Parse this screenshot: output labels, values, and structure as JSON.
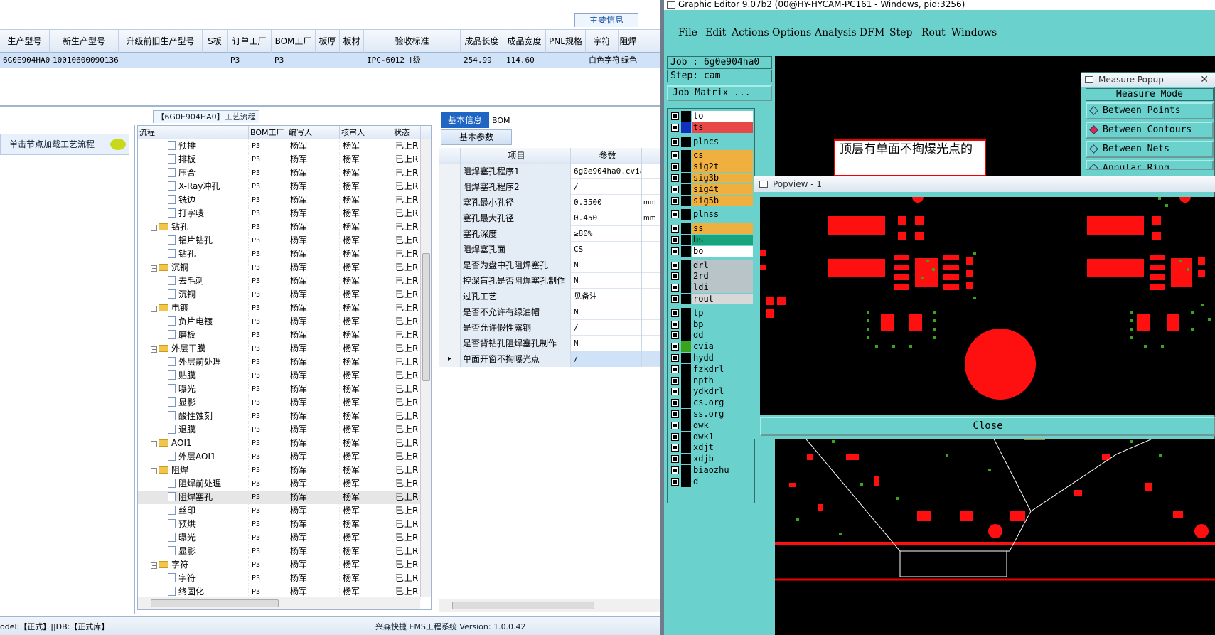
{
  "left": {
    "main_tab": "主要信息",
    "grid": {
      "columns": [
        "生产型号",
        "新生产型号",
        "升级前旧生产型号",
        "S板",
        "订单工厂",
        "BOM工厂",
        "板厚",
        "板材",
        "验收标准",
        "成品长度",
        "成品宽度",
        "PNL规格",
        "字符",
        "阻焊"
      ],
      "row": [
        "6G0E904HA0",
        "10010600090136",
        "",
        "",
        "P3",
        "P3",
        "",
        "",
        "IPC-6012 Ⅱ级",
        "254.99",
        "114.60",
        "",
        "白色字符",
        "绿色"
      ]
    },
    "process_title": "【6G0E904HA0】工艺流程",
    "nav_button": "单击节点加载工艺流程",
    "tree_headers": [
      "流程",
      "BOM工厂",
      "编写人",
      "核审人",
      "状态"
    ],
    "tree_rows": [
      {
        "name": "预排",
        "level": 2,
        "folder": false
      },
      {
        "name": "排板",
        "level": 2,
        "folder": false
      },
      {
        "name": "压合",
        "level": 2,
        "folder": false
      },
      {
        "name": "X-Ray冲孔",
        "level": 2,
        "folder": false
      },
      {
        "name": "铣边",
        "level": 2,
        "folder": false
      },
      {
        "name": "打字唛",
        "level": 2,
        "folder": false
      },
      {
        "name": "钻孔",
        "level": 1,
        "folder": true
      },
      {
        "name": "铝片钻孔",
        "level": 2,
        "folder": false
      },
      {
        "name": "钻孔",
        "level": 2,
        "folder": false
      },
      {
        "name": "沉铜",
        "level": 1,
        "folder": true
      },
      {
        "name": "去毛刺",
        "level": 2,
        "folder": false
      },
      {
        "name": "沉铜",
        "level": 2,
        "folder": false
      },
      {
        "name": "电镀",
        "level": 1,
        "folder": true
      },
      {
        "name": "负片电镀",
        "level": 2,
        "folder": false
      },
      {
        "name": "磨板",
        "level": 2,
        "folder": false
      },
      {
        "name": "外层干膜",
        "level": 1,
        "folder": true
      },
      {
        "name": "外层前处理",
        "level": 2,
        "folder": false
      },
      {
        "name": "贴膜",
        "level": 2,
        "folder": false
      },
      {
        "name": "曝光",
        "level": 2,
        "folder": false
      },
      {
        "name": "显影",
        "level": 2,
        "folder": false
      },
      {
        "name": "酸性蚀刻",
        "level": 2,
        "folder": false
      },
      {
        "name": "退膜",
        "level": 2,
        "folder": false
      },
      {
        "name": "AOI1",
        "level": 1,
        "folder": true
      },
      {
        "name": "外层AOI1",
        "level": 2,
        "folder": false
      },
      {
        "name": "阻焊",
        "level": 1,
        "folder": true
      },
      {
        "name": "阻焊前处理",
        "level": 2,
        "folder": false
      },
      {
        "name": "阻焊塞孔",
        "level": 2,
        "folder": false,
        "selected": true
      },
      {
        "name": "丝印",
        "level": 2,
        "folder": false
      },
      {
        "name": "预烘",
        "level": 2,
        "folder": false
      },
      {
        "name": "曝光",
        "level": 2,
        "folder": false
      },
      {
        "name": "显影",
        "level": 2,
        "folder": false
      },
      {
        "name": "字符",
        "level": 1,
        "folder": true
      },
      {
        "name": "字符",
        "level": 2,
        "folder": false
      },
      {
        "name": "终固化",
        "level": 2,
        "folder": false
      }
    ],
    "tree_common": {
      "bom": "P3",
      "writer": "杨军",
      "reviewer": "杨军",
      "status": "已上R"
    },
    "basic_tab": "基本信息",
    "bom_tab": "BOM",
    "basic_params": "基本参数",
    "param_headers": [
      "项目",
      "参数"
    ],
    "params": [
      {
        "name": "阻焊塞孔程序1",
        "value": "6g0e904ha0.cvia",
        "unit": ""
      },
      {
        "name": "阻焊塞孔程序2",
        "value": "/",
        "unit": ""
      },
      {
        "name": "塞孔最小孔径",
        "value": "0.3500",
        "unit": "mm"
      },
      {
        "name": "塞孔最大孔径",
        "value": "0.450",
        "unit": "mm"
      },
      {
        "name": "塞孔深度",
        "value": "≥80%",
        "unit": ""
      },
      {
        "name": "阻焊塞孔面",
        "value": "CS",
        "unit": ""
      },
      {
        "name": "是否为盘中孔阻焊塞孔",
        "value": "N",
        "unit": ""
      },
      {
        "name": "控深盲孔是否阻焊塞孔制作",
        "value": "N",
        "unit": ""
      },
      {
        "name": "过孔工艺",
        "value": "见备注",
        "unit": ""
      },
      {
        "name": "是否不允许有绿油帽",
        "value": "N",
        "unit": ""
      },
      {
        "name": "是否允许假性露铜",
        "value": "/",
        "unit": ""
      },
      {
        "name": "是否背钻孔阻焊塞孔制作",
        "value": "N",
        "unit": ""
      },
      {
        "name": "单面开窗不掏曝光点",
        "value": "/",
        "unit": ""
      }
    ],
    "status_left": "odel:【正式】||DB:【正式库】",
    "status_center": "兴森快捷 EMS工程系统 Version: 1.0.0.42"
  },
  "right": {
    "title": "Graphic Editor 9.07b2 (00@HY-HYCAM-PC161 - Windows, pid:3256)",
    "menu": [
      "File",
      "Edit",
      "Actions",
      "Options",
      "Analysis",
      "DFM",
      "Step",
      "Rout",
      "Windows"
    ],
    "job": "Job : 6g0e904ha0",
    "step": "Step: cam",
    "job_matrix": "Job Matrix ...",
    "layers": [
      {
        "name": "to",
        "color": "#ffffff",
        "marker": "#000000"
      },
      {
        "name": "ts",
        "color": "#e84848",
        "marker": "#1030c0"
      },
      {
        "name": "plncs",
        "color": "#6ad1cc",
        "marker": "#000000"
      },
      {
        "name": "cs",
        "color": "#f0b040",
        "marker": "#000000"
      },
      {
        "name": "sig2t",
        "color": "#f0b040",
        "marker": "#000000"
      },
      {
        "name": "sig3b",
        "color": "#f0b040",
        "marker": "#000000"
      },
      {
        "name": "sig4t",
        "color": "#f0b040",
        "marker": "#000000"
      },
      {
        "name": "sig5b",
        "color": "#f0b040",
        "marker": "#000000"
      },
      {
        "name": "plnss",
        "color": "#6ad1cc",
        "marker": "#000000"
      },
      {
        "name": "ss",
        "color": "#f0b040",
        "marker": "#000000"
      },
      {
        "name": "bs",
        "color": "#19a47c",
        "marker": "#000000"
      },
      {
        "name": "bo",
        "color": "#ffffff",
        "marker": "#000000"
      },
      {
        "name": "drl",
        "color": "#b8c4c8",
        "marker": "#000000"
      },
      {
        "name": "2rd",
        "color": "#b8c4c8",
        "marker": "#000000"
      },
      {
        "name": "ldi",
        "color": "#b8c4c8",
        "marker": "#000000"
      },
      {
        "name": "rout",
        "color": "#d8d8d8",
        "marker": "#000000"
      },
      {
        "name": "tp",
        "color": "#6ad1cc",
        "marker": "#000000"
      },
      {
        "name": "bp",
        "color": "#6ad1cc",
        "marker": "#000000"
      },
      {
        "name": "dd",
        "color": "#6ad1cc",
        "marker": "#000000"
      },
      {
        "name": "cvia",
        "color": "#6ad1cc",
        "marker": "#3aa41c"
      },
      {
        "name": "hydd",
        "color": "#6ad1cc",
        "marker": "#000000"
      },
      {
        "name": "fzkdrl",
        "color": "#6ad1cc",
        "marker": "#000000"
      },
      {
        "name": "npth",
        "color": "#6ad1cc",
        "marker": "#000000"
      },
      {
        "name": "ydkdrl",
        "color": "#6ad1cc",
        "marker": "#000000"
      },
      {
        "name": "cs.org",
        "color": "#6ad1cc",
        "marker": "#000000"
      },
      {
        "name": "ss.org",
        "color": "#6ad1cc",
        "marker": "#000000"
      },
      {
        "name": "dwk",
        "color": "#6ad1cc",
        "marker": "#000000"
      },
      {
        "name": "dwk1",
        "color": "#6ad1cc",
        "marker": "#000000"
      },
      {
        "name": "xdjt",
        "color": "#6ad1cc",
        "marker": "#000000"
      },
      {
        "name": "xdjb",
        "color": "#6ad1cc",
        "marker": "#000000"
      },
      {
        "name": "biaozhu",
        "color": "#6ad1cc",
        "marker": "#000000"
      },
      {
        "name": "d",
        "color": "#6ad1cc",
        "marker": "#000000"
      }
    ],
    "annotation": "顶层有单面不掏爆光点的",
    "measure": {
      "title": "Measure Popup",
      "mode": "Measure Mode",
      "items": [
        "Between Points",
        "Between Contours",
        "Between Nets",
        "Annular Ring"
      ]
    },
    "popview": {
      "title": "Popview - 1",
      "close": "Close"
    },
    "colors": {
      "teal": "#6ad1cc",
      "pad_red": "#ff1010",
      "via_green": "#3aa41c"
    }
  }
}
